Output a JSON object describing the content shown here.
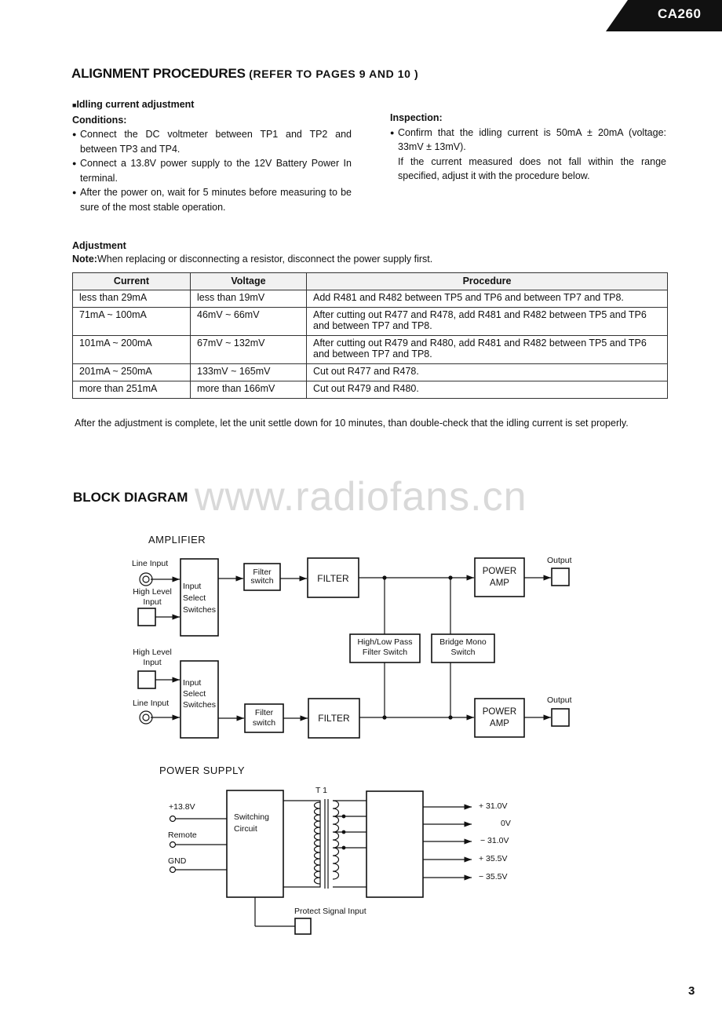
{
  "header": {
    "model": "CA260"
  },
  "alignment": {
    "title": "ALIGNMENT PROCEDURES",
    "subtitle": "(REFER TO PAGES 9 AND 10 )",
    "idling_heading": "Idling current adjustment",
    "conditions_heading": "Conditions:",
    "conditions": [
      "Connect the DC voltmeter between TP1 and TP2 and between TP3 and TP4.",
      "Connect a 13.8V power supply to the 12V Battery Power In terminal.",
      "After the power on, wait for 5 minutes before measuring to be sure of the most stable operation."
    ],
    "inspection_heading": "Inspection:",
    "inspection_bullet": "Confirm that the idling current is 50mA ± 20mA (voltage: 33mV ± 13mV).",
    "inspection_note": "If the current measured does not fall within the range specified, adjust it with the procedure below.",
    "adjustment_heading": "Adjustment",
    "note_label": "Note:",
    "note_text": "When replacing or disconnecting a resistor, disconnect the power supply first.",
    "table": {
      "headers": [
        "Current",
        "Voltage",
        "Procedure"
      ],
      "rows": [
        [
          "less than 29mA",
          "less than 19mV",
          "Add R481 and R482 between TP5 and TP6 and between TP7 and TP8."
        ],
        [
          "71mA ~ 100mA",
          "46mV ~ 66mV",
          "After cutting out R477 and R478, add R481 and R482 between TP5 and TP6 and between TP7 and TP8."
        ],
        [
          "101mA ~ 200mA",
          "67mV ~ 132mV",
          "After cutting out R479 and R480, add R481 and R482 between TP5 and TP6 and between TP7 and TP8."
        ],
        [
          "201mA ~ 250mA",
          "133mV ~ 165mV",
          "Cut out R477 and R478."
        ],
        [
          "more than 251mA",
          "more than 166mV",
          "Cut out R479 and R480."
        ]
      ]
    },
    "after_text": "After the adjustment is complete, let the unit settle down for 10 minutes, than double-check that the idling current is set properly."
  },
  "block_diagram": {
    "title": "BLOCK DIAGRAM",
    "watermark": "www.radiofans.cn",
    "amplifier": {
      "label": "AMPLIFIER",
      "line_input": "Line Input",
      "high_level_input": [
        "High Level",
        "Input"
      ],
      "input_select": [
        "Input",
        "Select",
        "Switches"
      ],
      "filter_switch": [
        "Filter",
        "switch"
      ],
      "filter": "FILTER",
      "power_amp": [
        "POWER",
        "AMP"
      ],
      "output": "Output",
      "hl_pass": [
        "High/Low Pass",
        "Filter Switch"
      ],
      "bridge_mono": [
        "Bridge Mono",
        "Switch"
      ]
    },
    "power_supply": {
      "label": "POWER SUPPLY",
      "transformer": "T 1",
      "inputs": [
        "+13.8V",
        "Remote",
        "GND"
      ],
      "switching": [
        "Switching",
        "Circuit"
      ],
      "outputs": [
        "+ 31.0V",
        "0V",
        "− 31.0V",
        "+ 35.5V",
        "− 35.5V"
      ],
      "protect": "Protect Signal Input"
    }
  },
  "footer": {
    "page_number": "3"
  }
}
